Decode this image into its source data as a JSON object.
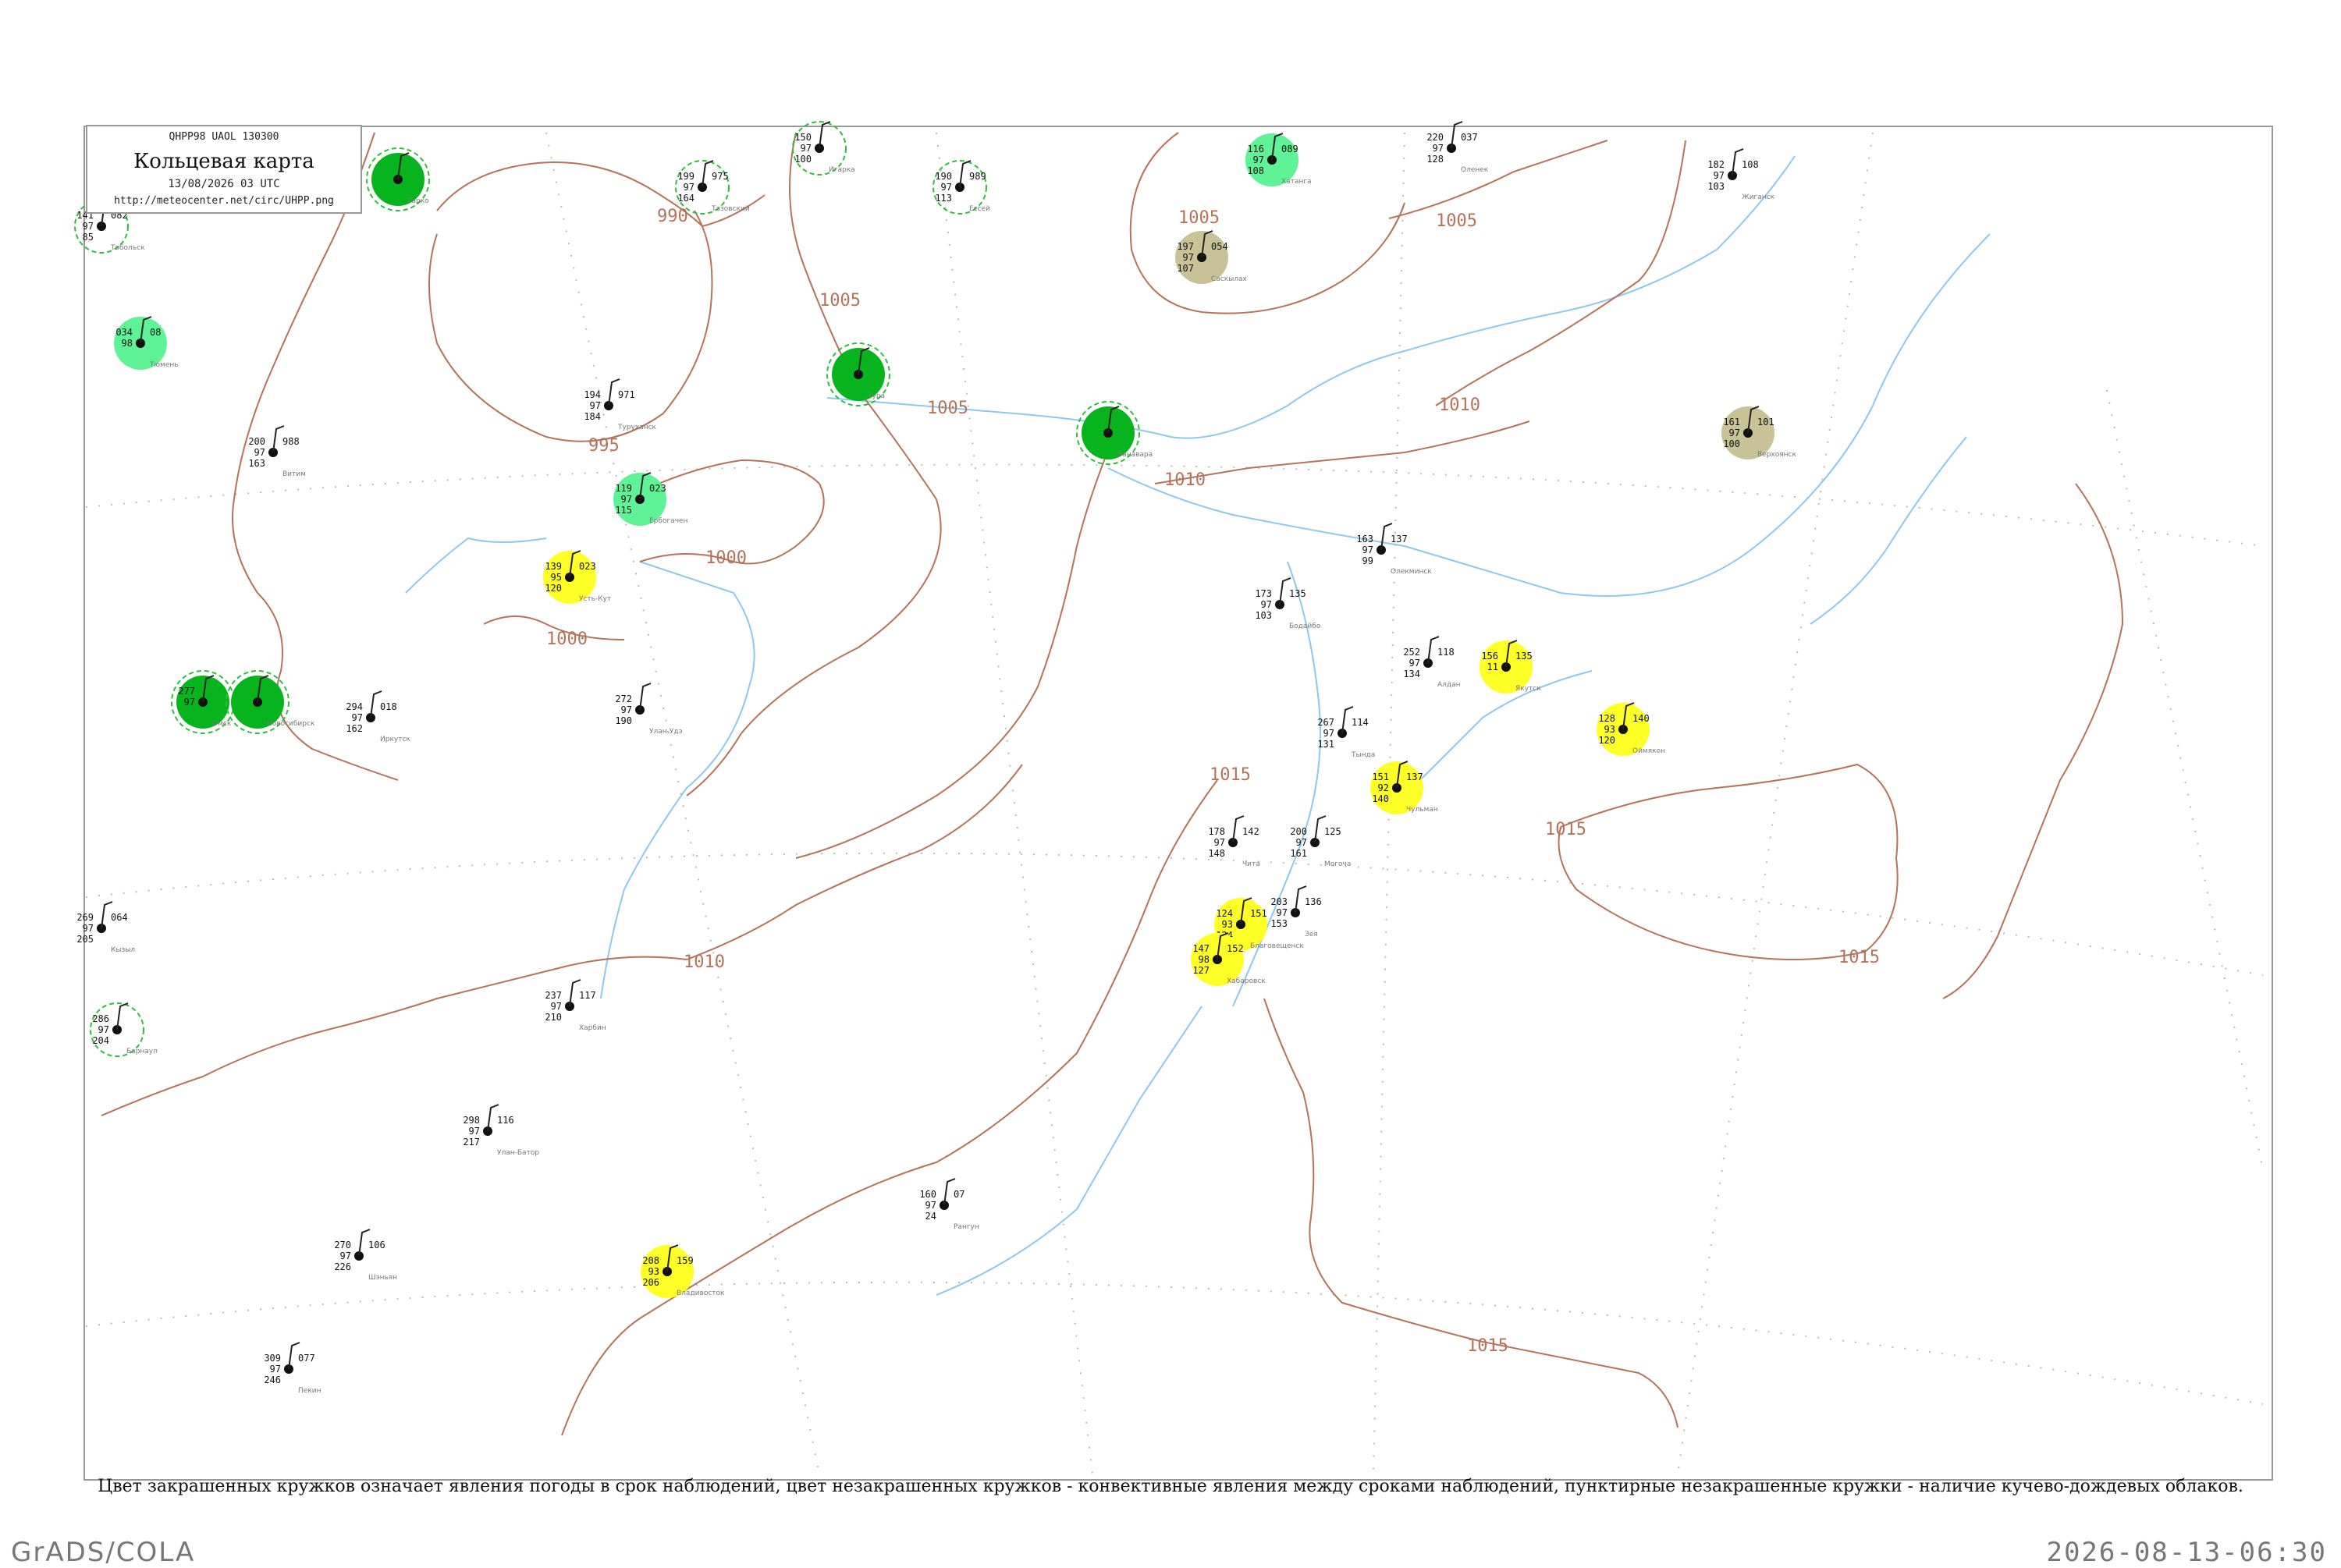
{
  "legend": {
    "code_line": "QHPP98  UAOL  130300",
    "title": "Кольцевая карта",
    "date": "13/08/2026 03 UTC",
    "url": "http://meteocenter.net/circ/UHPP.png"
  },
  "caption": "Цвет закрашенных кружков означает явления погоды в срок наблюдений, цвет незакрашенных кружков - конвективные явления между сроками наблюдений, пунктирные незакрашенные кружки - наличие кучево-дождевых облаков.",
  "footer": {
    "software": "GrADS/COLA",
    "timestamp": "2026-08-13-06:30"
  },
  "colors": {
    "isobar": "#b5735a",
    "river": "#8ec8ee",
    "frame": "#999999",
    "dark_green": "#08b41e",
    "light_green": "#5ff296",
    "yellow": "#ffff28",
    "olive": "#c8c396",
    "dashed_green": "#2fbf3c"
  },
  "isobar_labels": [
    "990",
    "995",
    "1000",
    "1000",
    "1005",
    "1005",
    "1005",
    "1005",
    "1010",
    "1010",
    "1010",
    "1015",
    "1015",
    "1015",
    "1015"
  ],
  "stations": [
    {
      "name": "Тобольск",
      "top": "141",
      "mid": "97",
      "bottom": "85",
      "right": "082",
      "state": "dashed"
    },
    {
      "name": "Тюмень",
      "top": "034",
      "mid": "98",
      "bottom": "",
      "right": "08",
      "state": "light_green"
    },
    {
      "name": "Тарко",
      "top": "",
      "mid": "",
      "bottom": "",
      "right": "",
      "state": "dark_green"
    },
    {
      "name": "Тазовский",
      "top": "199",
      "mid": "97",
      "bottom": "164",
      "right": "975",
      "state": "dashed"
    },
    {
      "name": "Игарка",
      "top": "150",
      "mid": "97",
      "bottom": "100",
      "right": "",
      "state": "dashed"
    },
    {
      "name": "Ессей",
      "top": "190",
      "mid": "97",
      "bottom": "113",
      "right": "989",
      "state": "dashed"
    },
    {
      "name": "Хатанга",
      "top": "116",
      "mid": "97",
      "bottom": "108",
      "right": "089",
      "state": "light_green"
    },
    {
      "name": "Оленек",
      "top": "220",
      "mid": "97",
      "bottom": "128",
      "right": "037",
      "state": "plain"
    },
    {
      "name": "Жиганск",
      "top": "182",
      "mid": "97",
      "bottom": "103",
      "right": "108",
      "state": "plain"
    },
    {
      "name": "Саскылах",
      "top": "197",
      "mid": "97",
      "bottom": "107",
      "right": "054",
      "state": "olive"
    },
    {
      "name": "Туруханск",
      "top": "194",
      "mid": "97",
      "bottom": "184",
      "right": "971",
      "state": "plain"
    },
    {
      "name": "Тура",
      "top": "",
      "mid": "",
      "bottom": "",
      "right": "",
      "state": "dark_green"
    },
    {
      "name": "Ванавара",
      "top": "",
      "mid": "",
      "bottom": "",
      "right": "",
      "state": "dark_green"
    },
    {
      "name": "Верхоянск",
      "top": "161",
      "mid": "97",
      "bottom": "100",
      "right": "101",
      "state": "olive"
    },
    {
      "name": "Витим",
      "top": "200",
      "mid": "97",
      "bottom": "163",
      "right": "988",
      "state": "plain"
    },
    {
      "name": "Ербогачен",
      "top": "119",
      "mid": "97",
      "bottom": "115",
      "right": "023",
      "state": "light_green"
    },
    {
      "name": "Усть-Кут",
      "top": "139",
      "mid": "95",
      "bottom": "120",
      "right": "023",
      "state": "yellow"
    },
    {
      "name": "Бодайбо",
      "top": "173",
      "mid": "97",
      "bottom": "103",
      "right": "135",
      "state": "plain"
    },
    {
      "name": "Олекминск",
      "top": "163",
      "mid": "97",
      "bottom": "99",
      "right": "137",
      "state": "plain"
    },
    {
      "name": "Якутск",
      "top": "156",
      "mid": "11",
      "bottom": "",
      "right": "135",
      "state": "yellow"
    },
    {
      "name": "Оймякон",
      "top": "128",
      "mid": "93",
      "bottom": "120",
      "right": "140",
      "state": "yellow"
    },
    {
      "name": "Алдан",
      "top": "252",
      "mid": "97",
      "bottom": "134",
      "right": "118",
      "state": "plain"
    },
    {
      "name": "Чульман",
      "top": "151",
      "mid": "92",
      "bottom": "140",
      "right": "137",
      "state": "yellow"
    },
    {
      "name": "Тында",
      "top": "267",
      "mid": "97",
      "bottom": "131",
      "right": "114",
      "state": "plain"
    },
    {
      "name": "Чита",
      "top": "178",
      "mid": "97",
      "bottom": "148",
      "right": "142",
      "state": "plain"
    },
    {
      "name": "Могоча",
      "top": "200",
      "mid": "97",
      "bottom": "161",
      "right": "125",
      "state": "plain"
    },
    {
      "name": "Благовещенск",
      "top": "124",
      "mid": "93",
      "bottom": "124",
      "right": "151",
      "state": "yellow"
    },
    {
      "name": "Зея",
      "top": "203",
      "mid": "97",
      "bottom": "153",
      "right": "136",
      "state": "plain"
    },
    {
      "name": "Хабаровск",
      "top": "147",
      "mid": "98",
      "bottom": "127",
      "right": "152",
      "state": "yellow"
    },
    {
      "name": "Иркутск",
      "top": "294",
      "mid": "97",
      "bottom": "162",
      "right": "018",
      "state": "plain"
    },
    {
      "name": "Улан-Удэ",
      "top": "272",
      "mid": "97",
      "bottom": "190",
      "right": "",
      "state": "plain"
    },
    {
      "name": "Кызыл",
      "top": "269",
      "mid": "97",
      "bottom": "205",
      "right": "064",
      "state": "plain"
    },
    {
      "name": "Барнаул",
      "top": "286",
      "mid": "97",
      "bottom": "204",
      "right": "",
      "state": "dashed"
    },
    {
      "name": "Улан-Батор",
      "top": "298",
      "mid": "97",
      "bottom": "217",
      "right": "116",
      "state": "plain"
    },
    {
      "name": "Владивосток",
      "top": "208",
      "mid": "93",
      "bottom": "206",
      "right": "159",
      "state": "yellow"
    },
    {
      "name": "Пекин",
      "top": "309",
      "mid": "97",
      "bottom": "246",
      "right": "077",
      "state": "plain"
    },
    {
      "name": "Рангун",
      "top": "160",
      "mid": "97",
      "bottom": "24",
      "right": "07",
      "state": "plain"
    },
    {
      "name": "Шэньян",
      "top": "270",
      "mid": "97",
      "bottom": "226",
      "right": "106",
      "state": "plain"
    },
    {
      "name": "Харбин",
      "top": "237",
      "mid": "97",
      "bottom": "210",
      "right": "117",
      "state": "plain"
    },
    {
      "name": "Омск",
      "top": "277",
      "mid": "97",
      "bottom": "",
      "right": "",
      "state": "dark_green"
    },
    {
      "name": "Новосибирск",
      "top": "",
      "mid": "",
      "bottom": "",
      "right": "",
      "state": "dark_green"
    }
  ]
}
